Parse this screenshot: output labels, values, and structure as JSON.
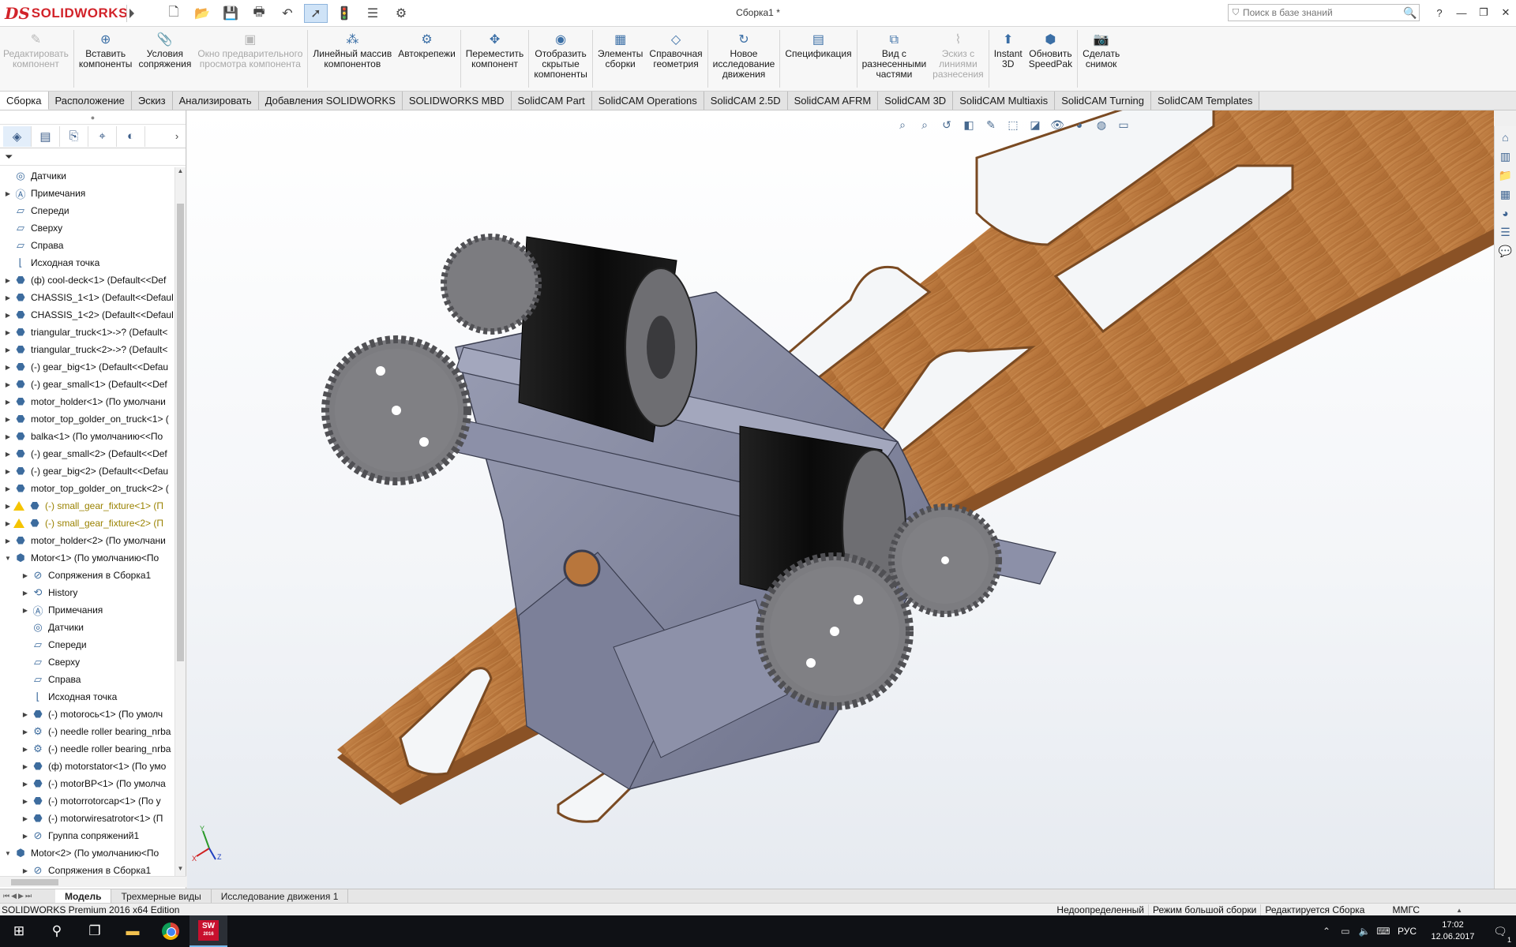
{
  "app": {
    "logo_prefix": "DS",
    "logo_name": "SOLIDWORKS",
    "doc_title": "Сборка1 *",
    "search_placeholder": "Поиск в базе знаний"
  },
  "ribbon": [
    {
      "id": "edit",
      "label": "Редактировать\nкомпонент",
      "icon": "edit-component-icon",
      "disabled": true
    },
    {
      "id": "insert",
      "label": "Вставить\nкомпоненты",
      "icon": "insert-components-icon",
      "disabled": false
    },
    {
      "id": "mates",
      "label": "Условия\nсопряжения",
      "icon": "paperclip-icon",
      "disabled": false
    },
    {
      "id": "preview",
      "label": "Окно предварительного\nпросмотра компонента",
      "icon": "preview-window-icon",
      "disabled": true
    },
    {
      "id": "pattern",
      "label": "Линейный массив\nкомпонентов",
      "icon": "linear-pattern-icon",
      "disabled": false
    },
    {
      "id": "fasteners",
      "label": "Автокрепежи",
      "icon": "smart-fasteners-icon",
      "disabled": false
    },
    {
      "id": "move",
      "label": "Переместить\nкомпонент",
      "icon": "move-component-icon",
      "disabled": false
    },
    {
      "id": "show",
      "label": "Отобразить\nскрытые\nкомпоненты",
      "icon": "show-hidden-icon",
      "disabled": false
    },
    {
      "id": "features",
      "label": "Элементы\nсборки",
      "icon": "assembly-features-icon",
      "disabled": false
    },
    {
      "id": "refgeom",
      "label": "Справочная\nгеометрия",
      "icon": "reference-geometry-icon",
      "disabled": false
    },
    {
      "id": "motion",
      "label": "Новое\nисследование\nдвижения",
      "icon": "motion-study-icon",
      "disabled": false
    },
    {
      "id": "bom",
      "label": "Спецификация",
      "icon": "bom-icon",
      "disabled": false
    },
    {
      "id": "exploded",
      "label": "Вид с\nразнесенными\nчастями",
      "icon": "exploded-view-icon",
      "disabled": false
    },
    {
      "id": "sketch",
      "label": "Эскиз с\nлиниями\nразнесения",
      "icon": "explode-line-sketch-icon",
      "disabled": true
    },
    {
      "id": "instant3d",
      "label": "Instant\n3D",
      "icon": "instant3d-icon",
      "disabled": false
    },
    {
      "id": "speedpak",
      "label": "Обновить\nSpeedPak",
      "icon": "speedpak-icon",
      "disabled": false
    },
    {
      "id": "snapshot",
      "label": "Сделать\nснимок",
      "icon": "camera-icon",
      "disabled": false
    }
  ],
  "command_tabs": [
    "Сборка",
    "Расположение",
    "Эскиз",
    "Анализировать",
    "Добавления SOLIDWORKS",
    "SOLIDWORKS MBD",
    "SolidCAM Part",
    "SolidCAM Operations",
    "SolidCAM 2.5D",
    "SolidCAM AFRM",
    "SolidCAM 3D",
    "SolidCAM Multiaxis",
    "SolidCAM Turning",
    "SolidCAM Templates"
  ],
  "tree": [
    {
      "label": "Датчики",
      "indent": 0,
      "expand": "",
      "icon": "sensor-icon"
    },
    {
      "label": "Примечания",
      "indent": 0,
      "expand": "▶",
      "icon": "annotations-icon"
    },
    {
      "label": "Спереди",
      "indent": 0,
      "expand": "",
      "icon": "plane-icon"
    },
    {
      "label": "Сверху",
      "indent": 0,
      "expand": "",
      "icon": "plane-icon"
    },
    {
      "label": "Справа",
      "indent": 0,
      "expand": "",
      "icon": "plane-icon"
    },
    {
      "label": "Исходная точка",
      "indent": 0,
      "expand": "",
      "icon": "origin-icon"
    },
    {
      "label": "(ф) cool-deck<1> (Default<<Def",
      "indent": 0,
      "expand": "▶",
      "icon": "part-icon"
    },
    {
      "label": "CHASSIS_1<1> (Default<<Defaul",
      "indent": 0,
      "expand": "▶",
      "icon": "part-icon"
    },
    {
      "label": "CHASSIS_1<2> (Default<<Defaul",
      "indent": 0,
      "expand": "▶",
      "icon": "part-icon"
    },
    {
      "label": "triangular_truck<1>->? (Default<",
      "indent": 0,
      "expand": "▶",
      "icon": "part-icon"
    },
    {
      "label": "triangular_truck<2>->? (Default<",
      "indent": 0,
      "expand": "▶",
      "icon": "part-icon"
    },
    {
      "label": "(-) gear_big<1> (Default<<Defau",
      "indent": 0,
      "expand": "▶",
      "icon": "part-icon"
    },
    {
      "label": "(-) gear_small<1> (Default<<Def",
      "indent": 0,
      "expand": "▶",
      "icon": "part-icon"
    },
    {
      "label": "motor_holder<1> (По умолчани",
      "indent": 0,
      "expand": "▶",
      "icon": "part-icon"
    },
    {
      "label": "motor_top_golder_on_truck<1> (",
      "indent": 0,
      "expand": "▶",
      "icon": "part-icon"
    },
    {
      "label": "balka<1> (По умолчанию<<По",
      "indent": 0,
      "expand": "▶",
      "icon": "part-icon"
    },
    {
      "label": "(-) gear_small<2> (Default<<Def",
      "indent": 0,
      "expand": "▶",
      "icon": "part-icon"
    },
    {
      "label": "(-) gear_big<2> (Default<<Defau",
      "indent": 0,
      "expand": "▶",
      "icon": "part-icon"
    },
    {
      "label": "motor_top_golder_on_truck<2> (",
      "indent": 0,
      "expand": "▶",
      "icon": "part-icon"
    },
    {
      "label": "(-) small_gear_fixture<1> (П",
      "indent": 0,
      "expand": "▶",
      "icon": "part-icon",
      "warning": true
    },
    {
      "label": "(-) small_gear_fixture<2> (П",
      "indent": 0,
      "expand": "▶",
      "icon": "part-icon",
      "warning": true
    },
    {
      "label": "motor_holder<2> (По умолчани",
      "indent": 0,
      "expand": "▶",
      "icon": "part-icon"
    },
    {
      "label": "Motor<1> (По умолчанию<По",
      "indent": 0,
      "expand": "▼",
      "icon": "assembly-icon"
    },
    {
      "label": "Сопряжения в Сборка1",
      "indent": 1,
      "expand": "▶",
      "icon": "mates-icon"
    },
    {
      "label": "History",
      "indent": 1,
      "expand": "▶",
      "icon": "history-icon"
    },
    {
      "label": "Примечания",
      "indent": 1,
      "expand": "▶",
      "icon": "annotations-icon"
    },
    {
      "label": "Датчики",
      "indent": 1,
      "expand": "",
      "icon": "sensor-icon"
    },
    {
      "label": "Спереди",
      "indent": 1,
      "expand": "",
      "icon": "plane-icon"
    },
    {
      "label": "Сверху",
      "indent": 1,
      "expand": "",
      "icon": "plane-icon"
    },
    {
      "label": "Справа",
      "indent": 1,
      "expand": "",
      "icon": "plane-icon"
    },
    {
      "label": "Исходная точка",
      "indent": 1,
      "expand": "",
      "icon": "origin-icon"
    },
    {
      "label": "(-) motoroсь<1> (По умолч",
      "indent": 1,
      "expand": "▶",
      "icon": "part-icon"
    },
    {
      "label": "(-) needle roller bearing_nrba",
      "indent": 1,
      "expand": "▶",
      "icon": "toolbox-part-icon"
    },
    {
      "label": "(-) needle roller bearing_nrba",
      "indent": 1,
      "expand": "▶",
      "icon": "toolbox-part-icon"
    },
    {
      "label": "(ф) motorstator<1> (По умо",
      "indent": 1,
      "expand": "▶",
      "icon": "part-icon"
    },
    {
      "label": "(-) motorBP<1> (По умолча",
      "indent": 1,
      "expand": "▶",
      "icon": "part-icon"
    },
    {
      "label": "(-) motorrotorcap<1> (По у",
      "indent": 1,
      "expand": "▶",
      "icon": "part-icon"
    },
    {
      "label": "(-) motorwiresatrotor<1> (П",
      "indent": 1,
      "expand": "▶",
      "icon": "part-icon"
    },
    {
      "label": "Группа сопряжений1",
      "indent": 1,
      "expand": "▶",
      "icon": "mates-icon"
    },
    {
      "label": "Motor<2> (По умолчанию<По",
      "indent": 0,
      "expand": "▼",
      "icon": "assembly-icon"
    },
    {
      "label": "Сопряжения в Сборка1",
      "indent": 1,
      "expand": "▶",
      "icon": "mates-icon"
    }
  ],
  "bottom_tabs": [
    "Модель",
    "Трехмерные виды",
    "Исследование движения 1"
  ],
  "status": {
    "edition": "SOLIDWORKS Premium 2016 x64 Edition",
    "state": "Недоопределенный",
    "mode": "Режим большой сборки",
    "editing": "Редактируется Сборка",
    "units": "ММГС"
  },
  "taskbar": {
    "lang": "РУС",
    "time": "17:02",
    "date": "12.06.2017",
    "notifications": "1"
  },
  "triad_labels": {
    "x": "X",
    "y": "Y",
    "z": "Z"
  }
}
